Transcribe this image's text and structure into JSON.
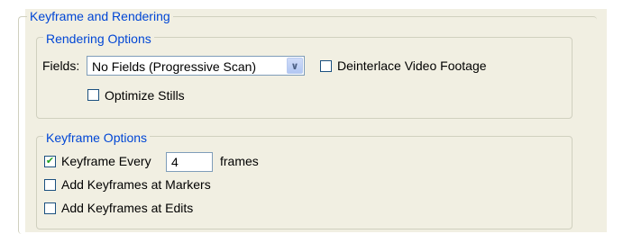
{
  "keyframe_rendering": {
    "title": "Keyframe and Rendering",
    "rendering_options": {
      "title": "Rendering Options",
      "fields_label": "Fields:",
      "fields_value": "No Fields (Progressive Scan)",
      "deinterlace_label": "Deinterlace Video Footage",
      "deinterlace_checked": false,
      "optimize_label": "Optimize Stills",
      "optimize_checked": false
    },
    "keyframe_options": {
      "title": "Keyframe Options",
      "keyframe_every_label": "Keyframe Every",
      "keyframe_every_checked": true,
      "keyframe_every_value": "4",
      "frames_label": "frames",
      "markers_label": "Add Keyframes at Markers",
      "markers_checked": false,
      "edits_label": "Add Keyframes at Edits",
      "edits_checked": false
    }
  },
  "icons": {
    "dropdown": "chevron-down-icon",
    "check": "checkmark-icon"
  },
  "colors": {
    "panel_bg": "#f1efe2",
    "group_title": "#0046d5",
    "group_border": "#d0d0bf",
    "field_border": "#7f9db9",
    "checkmark": "#21a121"
  }
}
